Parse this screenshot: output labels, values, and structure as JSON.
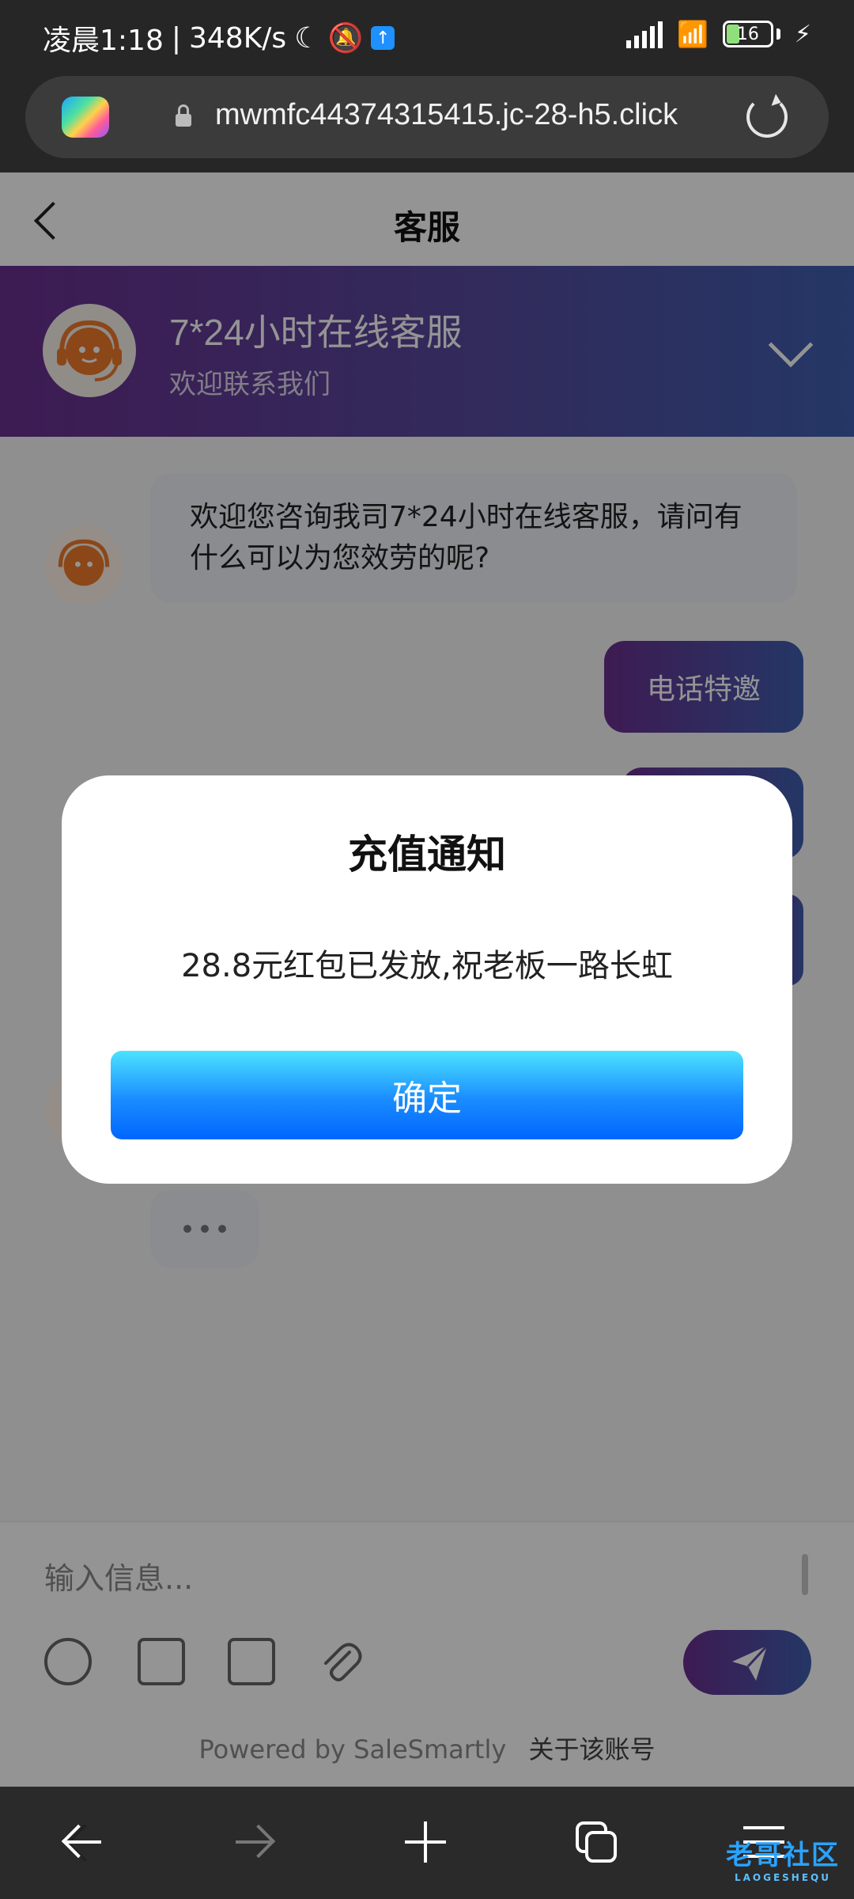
{
  "status": {
    "time": "凌晨1:18",
    "network_speed": "348K/s",
    "battery": "16"
  },
  "browser": {
    "url": "mwmfc44374315415.jc-28-h5.click"
  },
  "page": {
    "title": "客服"
  },
  "banner": {
    "title": "7*24小时在线客服",
    "subtitle": "欢迎联系我们"
  },
  "chat": {
    "welcome": "欢迎您咨询我司7*24小时在线客服，请问有什么可以为您效劳的呢?",
    "outgoing_1": "电话特邀"
  },
  "composer": {
    "placeholder": "输入信息...",
    "powered_by": "Powered by SaleSmartly",
    "about": "关于该账号"
  },
  "modal": {
    "title": "充值通知",
    "message": "28.8元红包已发放,祝老板一路长虹",
    "confirm": "确定"
  },
  "watermark": {
    "text": "老哥社区",
    "sub": "LAOGESHEQU"
  },
  "colors": {
    "banner_start": "#6a2f8f",
    "banner_end": "#3f5fb0",
    "confirm_top": "#4ce3ff",
    "confirm_bottom": "#0066ff"
  }
}
